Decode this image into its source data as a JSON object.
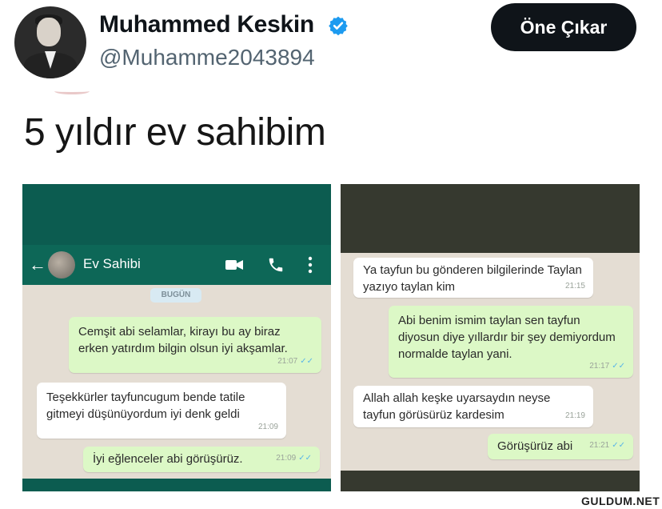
{
  "author": {
    "name": "Muhammed Keskin",
    "handle": "@Muhamme2043894",
    "verified_icon": "verified-badge-icon",
    "verified_color": "#1d9bf0"
  },
  "action_button": "Öne Çıkar",
  "tweet_text": "5 yıldır ev sahibim",
  "left_chat": {
    "contact_name": "Ev Sahibi",
    "header_color": "#0d6757",
    "date_chip": "BUGÜN",
    "messages": [
      {
        "side": "out",
        "text": "Cemşit abi selamlar, kirayı bu ay biraz erken yatırdım bilgin olsun iyi akşamlar.",
        "time": "21:07"
      },
      {
        "side": "in",
        "text": "Teşekkürler tayfuncugum bende tatile gitmeyi düşünüyordum iyi denk geldi",
        "time": "21:09"
      },
      {
        "side": "out",
        "text": "İyi eğlenceler abi görüşürüz.",
        "time": "21:09"
      }
    ]
  },
  "right_chat": {
    "messages": [
      {
        "side": "in",
        "text": "Ya tayfun bu gönderen bilgilerinde Taylan yazıyo taylan kim",
        "time": "21:15"
      },
      {
        "side": "out",
        "text": "Abi benim ismim taylan sen tayfun diyosun diye yıllardır bir şey demiyordum normalde taylan yani.",
        "time": "21:17"
      },
      {
        "side": "in",
        "text": "Allah allah keşke uyarsaydın neyse tayfun görüsürüz kardesim",
        "time": "21:19"
      },
      {
        "side": "out",
        "text": "Görüşürüz abi",
        "time": "21:21"
      }
    ]
  },
  "watermark": "GULDUM.NET"
}
